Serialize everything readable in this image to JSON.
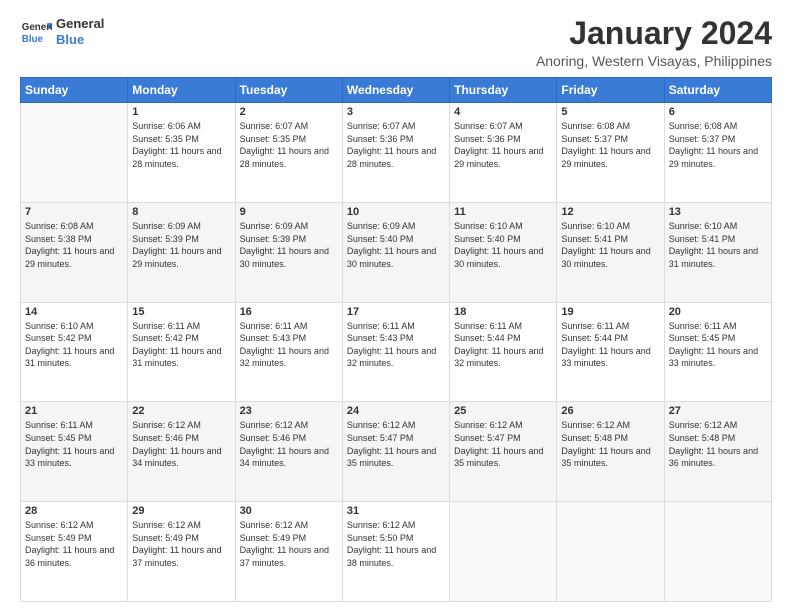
{
  "logo": {
    "line1": "General",
    "line2": "Blue"
  },
  "title": "January 2024",
  "subtitle": "Anoring, Western Visayas, Philippines",
  "days_header": [
    "Sunday",
    "Monday",
    "Tuesday",
    "Wednesday",
    "Thursday",
    "Friday",
    "Saturday"
  ],
  "weeks": [
    [
      {
        "day": "",
        "sunrise": "",
        "sunset": "",
        "daylight": ""
      },
      {
        "day": "1",
        "sunrise": "Sunrise: 6:06 AM",
        "sunset": "Sunset: 5:35 PM",
        "daylight": "Daylight: 11 hours and 28 minutes."
      },
      {
        "day": "2",
        "sunrise": "Sunrise: 6:07 AM",
        "sunset": "Sunset: 5:35 PM",
        "daylight": "Daylight: 11 hours and 28 minutes."
      },
      {
        "day": "3",
        "sunrise": "Sunrise: 6:07 AM",
        "sunset": "Sunset: 5:36 PM",
        "daylight": "Daylight: 11 hours and 28 minutes."
      },
      {
        "day": "4",
        "sunrise": "Sunrise: 6:07 AM",
        "sunset": "Sunset: 5:36 PM",
        "daylight": "Daylight: 11 hours and 29 minutes."
      },
      {
        "day": "5",
        "sunrise": "Sunrise: 6:08 AM",
        "sunset": "Sunset: 5:37 PM",
        "daylight": "Daylight: 11 hours and 29 minutes."
      },
      {
        "day": "6",
        "sunrise": "Sunrise: 6:08 AM",
        "sunset": "Sunset: 5:37 PM",
        "daylight": "Daylight: 11 hours and 29 minutes."
      }
    ],
    [
      {
        "day": "7",
        "sunrise": "Sunrise: 6:08 AM",
        "sunset": "Sunset: 5:38 PM",
        "daylight": "Daylight: 11 hours and 29 minutes."
      },
      {
        "day": "8",
        "sunrise": "Sunrise: 6:09 AM",
        "sunset": "Sunset: 5:39 PM",
        "daylight": "Daylight: 11 hours and 29 minutes."
      },
      {
        "day": "9",
        "sunrise": "Sunrise: 6:09 AM",
        "sunset": "Sunset: 5:39 PM",
        "daylight": "Daylight: 11 hours and 30 minutes."
      },
      {
        "day": "10",
        "sunrise": "Sunrise: 6:09 AM",
        "sunset": "Sunset: 5:40 PM",
        "daylight": "Daylight: 11 hours and 30 minutes."
      },
      {
        "day": "11",
        "sunrise": "Sunrise: 6:10 AM",
        "sunset": "Sunset: 5:40 PM",
        "daylight": "Daylight: 11 hours and 30 minutes."
      },
      {
        "day": "12",
        "sunrise": "Sunrise: 6:10 AM",
        "sunset": "Sunset: 5:41 PM",
        "daylight": "Daylight: 11 hours and 30 minutes."
      },
      {
        "day": "13",
        "sunrise": "Sunrise: 6:10 AM",
        "sunset": "Sunset: 5:41 PM",
        "daylight": "Daylight: 11 hours and 31 minutes."
      }
    ],
    [
      {
        "day": "14",
        "sunrise": "Sunrise: 6:10 AM",
        "sunset": "Sunset: 5:42 PM",
        "daylight": "Daylight: 11 hours and 31 minutes."
      },
      {
        "day": "15",
        "sunrise": "Sunrise: 6:11 AM",
        "sunset": "Sunset: 5:42 PM",
        "daylight": "Daylight: 11 hours and 31 minutes."
      },
      {
        "day": "16",
        "sunrise": "Sunrise: 6:11 AM",
        "sunset": "Sunset: 5:43 PM",
        "daylight": "Daylight: 11 hours and 32 minutes."
      },
      {
        "day": "17",
        "sunrise": "Sunrise: 6:11 AM",
        "sunset": "Sunset: 5:43 PM",
        "daylight": "Daylight: 11 hours and 32 minutes."
      },
      {
        "day": "18",
        "sunrise": "Sunrise: 6:11 AM",
        "sunset": "Sunset: 5:44 PM",
        "daylight": "Daylight: 11 hours and 32 minutes."
      },
      {
        "day": "19",
        "sunrise": "Sunrise: 6:11 AM",
        "sunset": "Sunset: 5:44 PM",
        "daylight": "Daylight: 11 hours and 33 minutes."
      },
      {
        "day": "20",
        "sunrise": "Sunrise: 6:11 AM",
        "sunset": "Sunset: 5:45 PM",
        "daylight": "Daylight: 11 hours and 33 minutes."
      }
    ],
    [
      {
        "day": "21",
        "sunrise": "Sunrise: 6:11 AM",
        "sunset": "Sunset: 5:45 PM",
        "daylight": "Daylight: 11 hours and 33 minutes."
      },
      {
        "day": "22",
        "sunrise": "Sunrise: 6:12 AM",
        "sunset": "Sunset: 5:46 PM",
        "daylight": "Daylight: 11 hours and 34 minutes."
      },
      {
        "day": "23",
        "sunrise": "Sunrise: 6:12 AM",
        "sunset": "Sunset: 5:46 PM",
        "daylight": "Daylight: 11 hours and 34 minutes."
      },
      {
        "day": "24",
        "sunrise": "Sunrise: 6:12 AM",
        "sunset": "Sunset: 5:47 PM",
        "daylight": "Daylight: 11 hours and 35 minutes."
      },
      {
        "day": "25",
        "sunrise": "Sunrise: 6:12 AM",
        "sunset": "Sunset: 5:47 PM",
        "daylight": "Daylight: 11 hours and 35 minutes."
      },
      {
        "day": "26",
        "sunrise": "Sunrise: 6:12 AM",
        "sunset": "Sunset: 5:48 PM",
        "daylight": "Daylight: 11 hours and 35 minutes."
      },
      {
        "day": "27",
        "sunrise": "Sunrise: 6:12 AM",
        "sunset": "Sunset: 5:48 PM",
        "daylight": "Daylight: 11 hours and 36 minutes."
      }
    ],
    [
      {
        "day": "28",
        "sunrise": "Sunrise: 6:12 AM",
        "sunset": "Sunset: 5:49 PM",
        "daylight": "Daylight: 11 hours and 36 minutes."
      },
      {
        "day": "29",
        "sunrise": "Sunrise: 6:12 AM",
        "sunset": "Sunset: 5:49 PM",
        "daylight": "Daylight: 11 hours and 37 minutes."
      },
      {
        "day": "30",
        "sunrise": "Sunrise: 6:12 AM",
        "sunset": "Sunset: 5:49 PM",
        "daylight": "Daylight: 11 hours and 37 minutes."
      },
      {
        "day": "31",
        "sunrise": "Sunrise: 6:12 AM",
        "sunset": "Sunset: 5:50 PM",
        "daylight": "Daylight: 11 hours and 38 minutes."
      },
      {
        "day": "",
        "sunrise": "",
        "sunset": "",
        "daylight": ""
      },
      {
        "day": "",
        "sunrise": "",
        "sunset": "",
        "daylight": ""
      },
      {
        "day": "",
        "sunrise": "",
        "sunset": "",
        "daylight": ""
      }
    ]
  ]
}
